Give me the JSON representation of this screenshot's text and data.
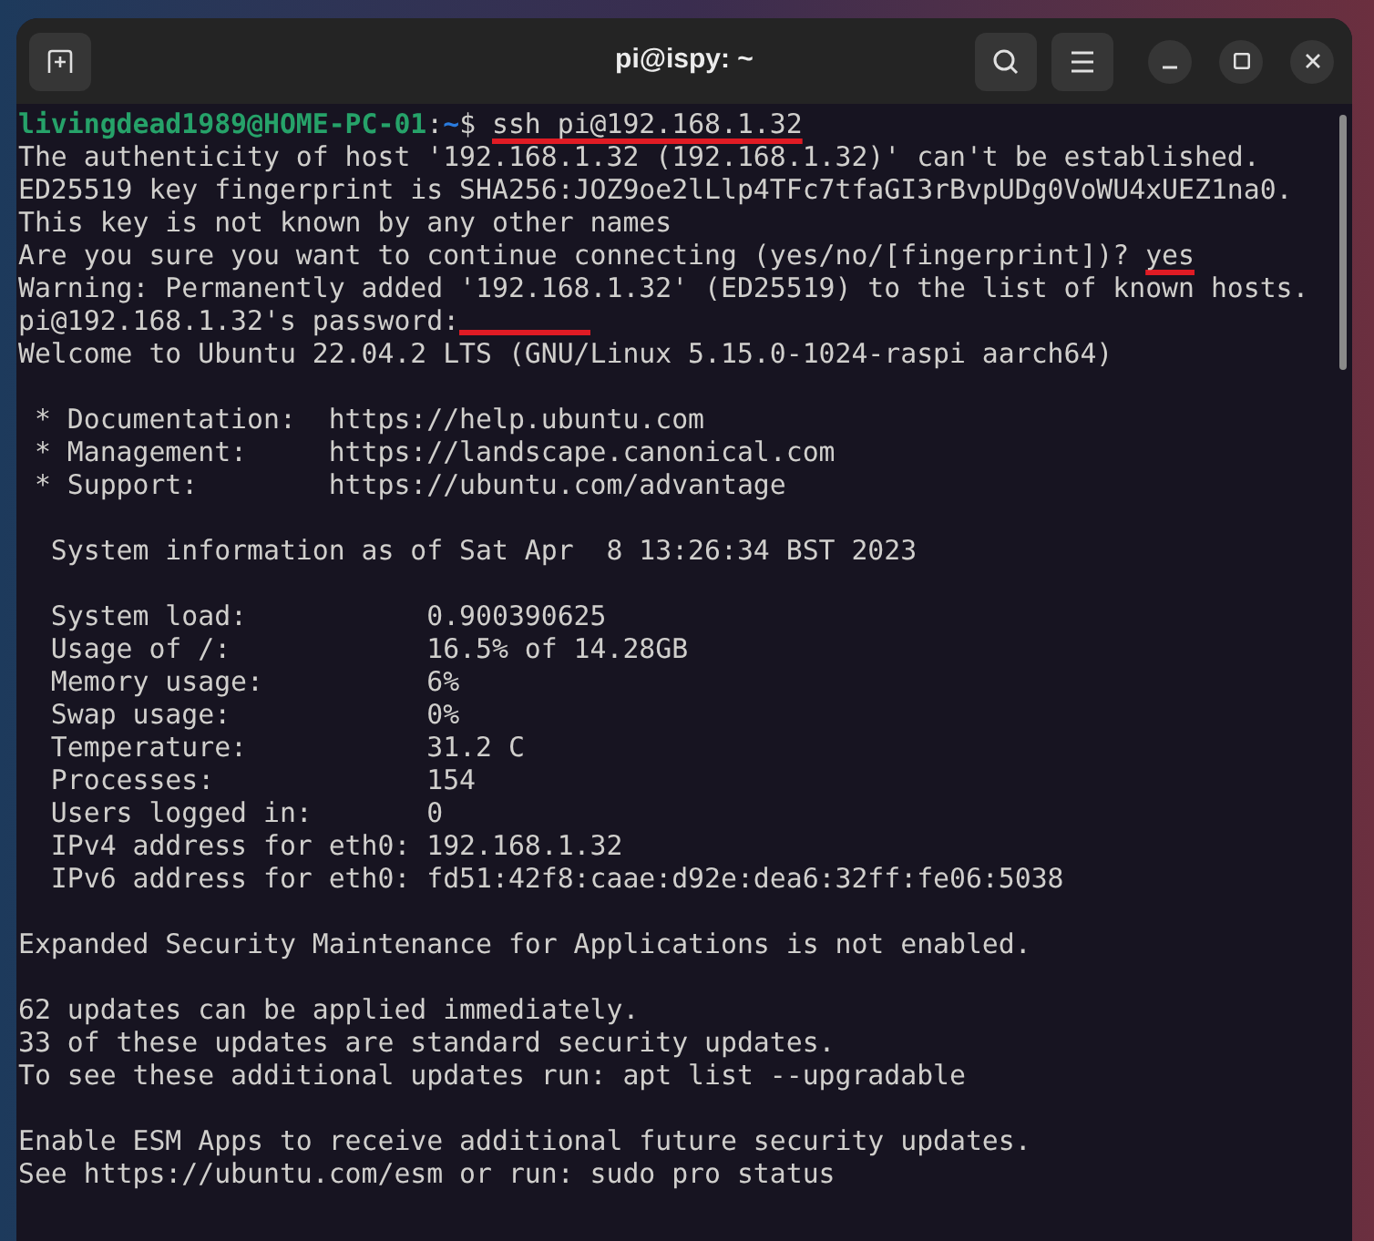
{
  "window": {
    "title": "pi@ispy: ~"
  },
  "terminal": {
    "lines": [
      {
        "kind": "prompt",
        "user": "livingdead1989@HOME-PC-01",
        "separator": ":",
        "path": "~",
        "symbol": "$",
        "command": "ssh pi@192.168.1.32",
        "underlined": true
      },
      {
        "kind": "output",
        "text": "The authenticity of host '192.168.1.32 (192.168.1.32)' can't be established."
      },
      {
        "kind": "output",
        "text": "ED25519 key fingerprint is SHA256:JOZ9oe2lLlp4TFc7tfaGI3rBvpUDg0VoWU4xUEZ1na0."
      },
      {
        "kind": "output",
        "text": "This key is not known by any other names"
      },
      {
        "kind": "output",
        "text": "Are you sure you want to continue connecting (yes/no/[fingerprint])? ",
        "answer": "yes",
        "underlined": true
      },
      {
        "kind": "output",
        "text": "Warning: Permanently added '192.168.1.32' (ED25519) to the list of known hosts."
      },
      {
        "kind": "output",
        "text": "pi@192.168.1.32's password:",
        "redaction_mark": true
      },
      {
        "kind": "output",
        "text": "Welcome to Ubuntu 22.04.2 LTS (GNU/Linux 5.15.0-1024-raspi aarch64)"
      },
      {
        "kind": "blank"
      },
      {
        "kind": "output",
        "text": " * Documentation:  https://help.ubuntu.com"
      },
      {
        "kind": "output",
        "text": " * Management:     https://landscape.canonical.com"
      },
      {
        "kind": "output",
        "text": " * Support:        https://ubuntu.com/advantage"
      },
      {
        "kind": "blank"
      },
      {
        "kind": "output",
        "text": "  System information as of Sat Apr  8 13:26:34 BST 2023"
      },
      {
        "kind": "blank"
      },
      {
        "kind": "output",
        "text": "  System load:           0.900390625"
      },
      {
        "kind": "output",
        "text": "  Usage of /:            16.5% of 14.28GB"
      },
      {
        "kind": "output",
        "text": "  Memory usage:          6%"
      },
      {
        "kind": "output",
        "text": "  Swap usage:            0%"
      },
      {
        "kind": "output",
        "text": "  Temperature:           31.2 C"
      },
      {
        "kind": "output",
        "text": "  Processes:             154"
      },
      {
        "kind": "output",
        "text": "  Users logged in:       0"
      },
      {
        "kind": "output",
        "text": "  IPv4 address for eth0: 192.168.1.32"
      },
      {
        "kind": "output",
        "text": "  IPv6 address for eth0: fd51:42f8:caae:d92e:dea6:32ff:fe06:5038"
      },
      {
        "kind": "blank"
      },
      {
        "kind": "output",
        "text": "Expanded Security Maintenance for Applications is not enabled."
      },
      {
        "kind": "blank"
      },
      {
        "kind": "output",
        "text": "62 updates can be applied immediately."
      },
      {
        "kind": "output",
        "text": "33 of these updates are standard security updates."
      },
      {
        "kind": "output",
        "text": "To see these additional updates run: apt list --upgradable"
      },
      {
        "kind": "blank"
      },
      {
        "kind": "output",
        "text": "Enable ESM Apps to receive additional future security updates."
      },
      {
        "kind": "output",
        "text": "See https://ubuntu.com/esm or run: sudo pro status"
      }
    ]
  }
}
